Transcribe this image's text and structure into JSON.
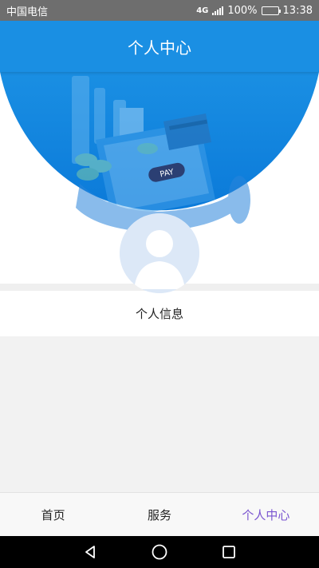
{
  "status_bar": {
    "carrier": "中国电信",
    "network": "4G",
    "battery_percent": "100%",
    "time": "13:38"
  },
  "header": {
    "title": "个人中心"
  },
  "hero": {
    "badge_text": "PAY",
    "illustration": "payment-hand-phone-illustration",
    "bg_color": "#1a8fe3"
  },
  "profile": {
    "avatar_icon": "user-avatar-icon",
    "info_label": "个人信息"
  },
  "bottom_nav": {
    "items": [
      {
        "label": "首页",
        "active": false
      },
      {
        "label": "服务",
        "active": false
      },
      {
        "label": "个人中心",
        "active": true
      }
    ],
    "active_color": "#7a55d0"
  },
  "system_nav": {
    "icons": [
      "back-icon",
      "home-icon",
      "recent-apps-icon"
    ]
  }
}
